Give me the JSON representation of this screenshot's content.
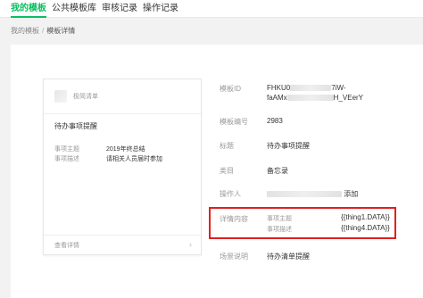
{
  "tabs": [
    {
      "label": "我的模板",
      "active": true
    },
    {
      "label": "公共模板库",
      "active": false
    },
    {
      "label": "审核记录",
      "active": false
    },
    {
      "label": "操作记录",
      "active": false
    }
  ],
  "breadcrumb": {
    "parent": "我的模板",
    "separator": "/",
    "current": "模板详情"
  },
  "preview": {
    "app_name": "极简清单",
    "title": "待办事项提醒",
    "rows": [
      {
        "label": "事项主题",
        "value": "2019年终总结"
      },
      {
        "label": "事项描述",
        "value": "请相关人员届时参加"
      }
    ],
    "footer": "查看详情",
    "footer_icon": "chevron-right-icon"
  },
  "details": {
    "template_id_label": "模板ID",
    "template_id_line1_prefix": "FHKU0",
    "template_id_line1_suffix": "7iW-",
    "template_id_line2_prefix": "faAMx",
    "template_id_line2_suffix": "H_VEerY",
    "template_no_label": "模板编号",
    "template_no": "2983",
    "title_label": "标题",
    "title": "待办事项提醒",
    "category_label": "类目",
    "category": "备忘录",
    "operator_label": "操作人",
    "operator_action": "添加",
    "content_label": "详情内容",
    "content_fields": [
      {
        "name": "事项主题",
        "var": "{{thing1.DATA}}"
      },
      {
        "name": "事项描述",
        "var": "{{thing4.DATA}}"
      }
    ],
    "scene_label": "场景说明",
    "scene": "待办清单提醒"
  },
  "colors": {
    "accent": "#07c160",
    "highlight": "#e02020"
  }
}
